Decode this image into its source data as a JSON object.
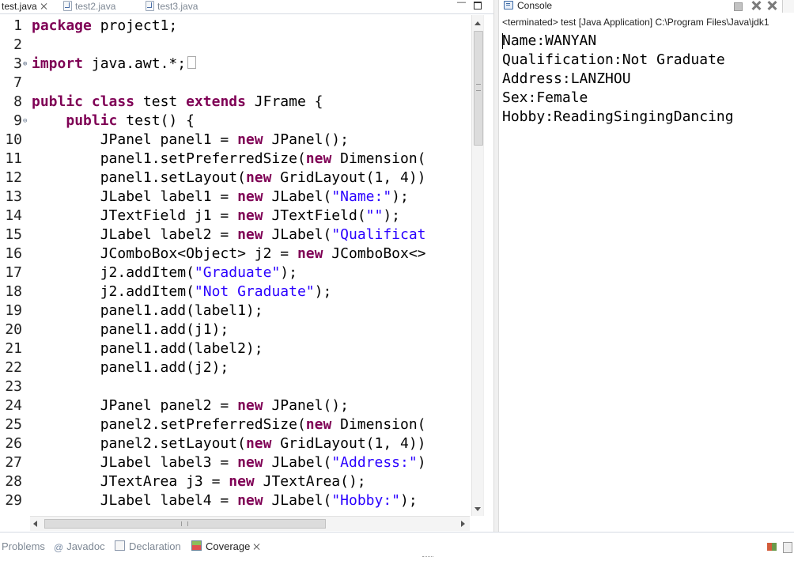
{
  "editor": {
    "tabs": [
      {
        "label": "test.java",
        "active": true,
        "closable": true
      },
      {
        "label": "test2.java",
        "active": false
      },
      {
        "label": "test3.java",
        "active": false
      }
    ],
    "minimize_label": "—",
    "lines": [
      {
        "n": "1",
        "fold": "",
        "tokens": [
          [
            "kw",
            "package"
          ],
          [
            "",
            " project1;"
          ]
        ]
      },
      {
        "n": "2",
        "fold": "",
        "tokens": []
      },
      {
        "n": "3",
        "fold": "⊕",
        "tokens": [
          [
            "kw",
            "import"
          ],
          [
            "",
            " java.awt.*;"
          ]
        ],
        "collapsed": true
      },
      {
        "n": "7",
        "fold": "",
        "tokens": []
      },
      {
        "n": "8",
        "fold": "",
        "tokens": [
          [
            "kw",
            "public"
          ],
          [
            "",
            " "
          ],
          [
            "kw",
            "class"
          ],
          [
            "",
            " test "
          ],
          [
            "kw",
            "extends"
          ],
          [
            "",
            " JFrame {"
          ]
        ]
      },
      {
        "n": "9",
        "fold": "⊖",
        "tokens": [
          [
            "",
            "    "
          ],
          [
            "kw",
            "public"
          ],
          [
            "",
            " test() {"
          ]
        ]
      },
      {
        "n": "10",
        "fold": "",
        "tokens": [
          [
            "",
            "        JPanel panel1 = "
          ],
          [
            "kw",
            "new"
          ],
          [
            "",
            " JPanel();"
          ]
        ]
      },
      {
        "n": "11",
        "fold": "",
        "tokens": [
          [
            "",
            "        panel1.setPreferredSize("
          ],
          [
            "kw",
            "new"
          ],
          [
            "",
            " Dimension("
          ]
        ]
      },
      {
        "n": "12",
        "fold": "",
        "tokens": [
          [
            "",
            "        panel1.setLayout("
          ],
          [
            "kw",
            "new"
          ],
          [
            "",
            " GridLayout(1, 4))"
          ]
        ]
      },
      {
        "n": "13",
        "fold": "",
        "tokens": [
          [
            "",
            "        JLabel label1 = "
          ],
          [
            "kw",
            "new"
          ],
          [
            "",
            " JLabel("
          ],
          [
            "str",
            "\"Name:\""
          ],
          [
            "",
            ");"
          ]
        ]
      },
      {
        "n": "14",
        "fold": "",
        "tokens": [
          [
            "",
            "        JTextField j1 = "
          ],
          [
            "kw",
            "new"
          ],
          [
            "",
            " JTextField("
          ],
          [
            "str",
            "\"\""
          ],
          [
            "",
            ");"
          ]
        ]
      },
      {
        "n": "15",
        "fold": "",
        "tokens": [
          [
            "",
            "        JLabel label2 = "
          ],
          [
            "kw",
            "new"
          ],
          [
            "",
            " JLabel("
          ],
          [
            "str",
            "\"Qualificat"
          ]
        ]
      },
      {
        "n": "16",
        "fold": "",
        "tokens": [
          [
            "",
            "        JComboBox<Object> j2 = "
          ],
          [
            "kw",
            "new"
          ],
          [
            "",
            " JComboBox<>"
          ]
        ]
      },
      {
        "n": "17",
        "fold": "",
        "tokens": [
          [
            "",
            "        j2.addItem("
          ],
          [
            "str",
            "\"Graduate\""
          ],
          [
            "",
            ");"
          ]
        ]
      },
      {
        "n": "18",
        "fold": "",
        "tokens": [
          [
            "",
            "        j2.addItem("
          ],
          [
            "str",
            "\"Not Graduate\""
          ],
          [
            "",
            ");"
          ]
        ]
      },
      {
        "n": "19",
        "fold": "",
        "tokens": [
          [
            "",
            "        panel1.add(label1);"
          ]
        ]
      },
      {
        "n": "20",
        "fold": "",
        "tokens": [
          [
            "",
            "        panel1.add(j1);"
          ]
        ]
      },
      {
        "n": "21",
        "fold": "",
        "tokens": [
          [
            "",
            "        panel1.add(label2);"
          ]
        ]
      },
      {
        "n": "22",
        "fold": "",
        "tokens": [
          [
            "",
            "        panel1.add(j2);"
          ]
        ]
      },
      {
        "n": "23",
        "fold": "",
        "tokens": []
      },
      {
        "n": "24",
        "fold": "",
        "tokens": [
          [
            "",
            "        JPanel panel2 = "
          ],
          [
            "kw",
            "new"
          ],
          [
            "",
            " JPanel();"
          ]
        ]
      },
      {
        "n": "25",
        "fold": "",
        "tokens": [
          [
            "",
            "        panel2.setPreferredSize("
          ],
          [
            "kw",
            "new"
          ],
          [
            "",
            " Dimension("
          ]
        ]
      },
      {
        "n": "26",
        "fold": "",
        "tokens": [
          [
            "",
            "        panel2.setLayout("
          ],
          [
            "kw",
            "new"
          ],
          [
            "",
            " GridLayout(1, 4))"
          ]
        ]
      },
      {
        "n": "27",
        "fold": "",
        "tokens": [
          [
            "",
            "        JLabel label3 = "
          ],
          [
            "kw",
            "new"
          ],
          [
            "",
            " JLabel("
          ],
          [
            "str",
            "\"Address:\""
          ],
          [
            "",
            ")"
          ]
        ]
      },
      {
        "n": "28",
        "fold": "",
        "tokens": [
          [
            "",
            "        JTextArea j3 = "
          ],
          [
            "kw",
            "new"
          ],
          [
            "",
            " JTextArea();"
          ]
        ]
      },
      {
        "n": "29",
        "fold": "",
        "tokens": [
          [
            "",
            "        JLabel label4 = "
          ],
          [
            "kw",
            "new"
          ],
          [
            "",
            " JLabel("
          ],
          [
            "str",
            "\"Hobby:\""
          ],
          [
            "",
            ");"
          ]
        ]
      }
    ],
    "horizontal_scroll_grip": "III"
  },
  "console": {
    "tab_label": "Console",
    "status": "<terminated> test [Java Application] C:\\Program Files\\Java\\jdk1",
    "output": [
      "Name:WANYAN",
      "Qualification:Not Graduate",
      "Address:LANZHOU",
      "Sex:Female",
      "Hobby:ReadingSingingDancing"
    ]
  },
  "bottom_tabs": [
    {
      "label": "Problems",
      "icon": "problems-icon"
    },
    {
      "label": "Javadoc",
      "icon": "javadoc-icon",
      "glyph": "@"
    },
    {
      "label": "Declaration",
      "icon": "declaration-icon"
    },
    {
      "label": "Coverage",
      "icon": "coverage-icon",
      "active": true
    }
  ],
  "colors": {
    "keyword": "#7f0055",
    "string": "#2a00ff",
    "text": "#000000",
    "tab_inactive": "#7e8894"
  }
}
